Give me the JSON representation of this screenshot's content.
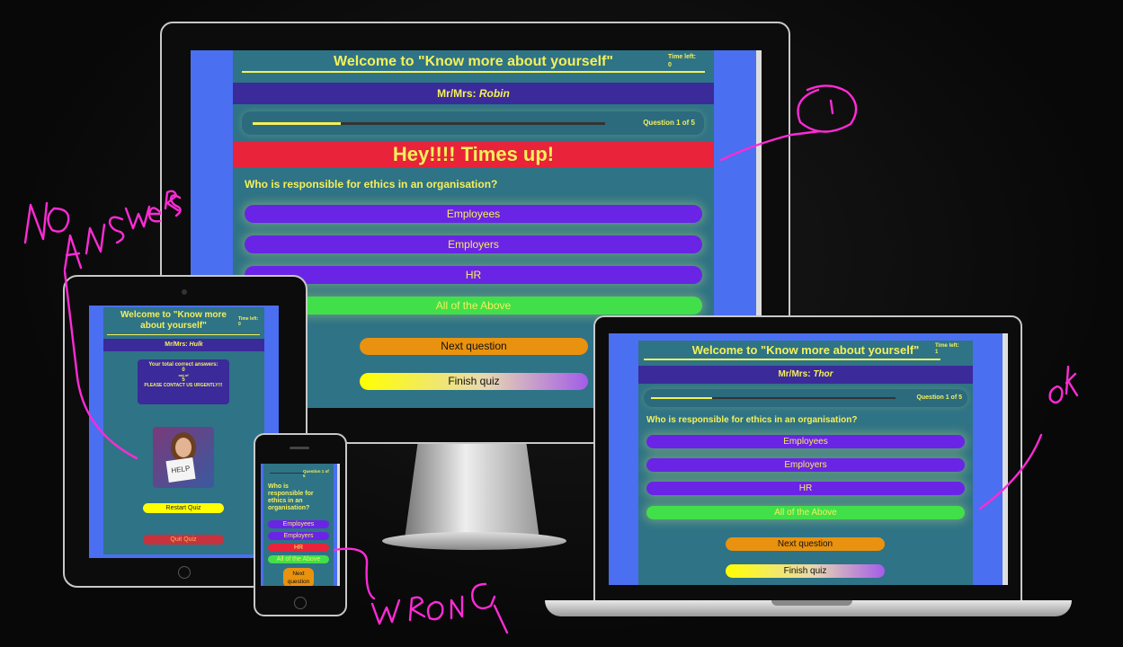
{
  "quiz_title": "Welcome to \"Know more about yourself\"",
  "time_left_label": "Time left:",
  "question_text": "Who is responsible for ethics in an organisation?",
  "answers": [
    "Employees",
    "Employers",
    "HR",
    "All of the Above"
  ],
  "next_label": "Next question",
  "finish_label": "Finish quiz",
  "desktop": {
    "user_prefix": "Mr/Mrs:",
    "user_name": "Robin",
    "time_left_value": "0",
    "progress_label": "Question 1 of 5",
    "progress_fraction": 0.25,
    "alert": "Hey!!!! Times up!"
  },
  "laptop": {
    "user_prefix": "Mr/Mrs:",
    "user_name": "Thor",
    "time_left_value": "1",
    "progress_label": "Question 1 of 5",
    "progress_fraction": 0.25
  },
  "tablet": {
    "title_line1": "Welcome to \"Know more",
    "title_line2": "about yourself\"",
    "time_left_value": "0",
    "user_prefix": "Mr/Mrs:",
    "user_name": "Hulk",
    "result_title": "Your total correct answers:",
    "result_score": "0",
    "result_outof": "out of",
    "result_total": "5",
    "result_note": "PLEASE CONTACT US URGENTLY!!!",
    "image_sign_text": "HELP",
    "restart_label": "Restart Quiz",
    "quit_label": "Quit Quiz"
  },
  "phone": {
    "progress_label": "Question 1 of 5",
    "question_text": "Who is responsible for ethics in an organisation?",
    "answers": [
      "Employees",
      "Employers",
      "HR",
      "All of the Above"
    ],
    "next_label": "Next question"
  },
  "annotations": {
    "no_answers": "NO ANSWERS",
    "one": "1",
    "ok": "OK",
    "wrong": "WRONG"
  },
  "colors": {
    "page_bg": "#2f7386",
    "screen_bg": "#4a6ff0",
    "answer": "#6a24e6",
    "correct": "#41e04a",
    "wrong": "#e8233a",
    "times_up": "#e8233a",
    "title_text": "#f4f05a",
    "ink": "#ff2bd6"
  }
}
